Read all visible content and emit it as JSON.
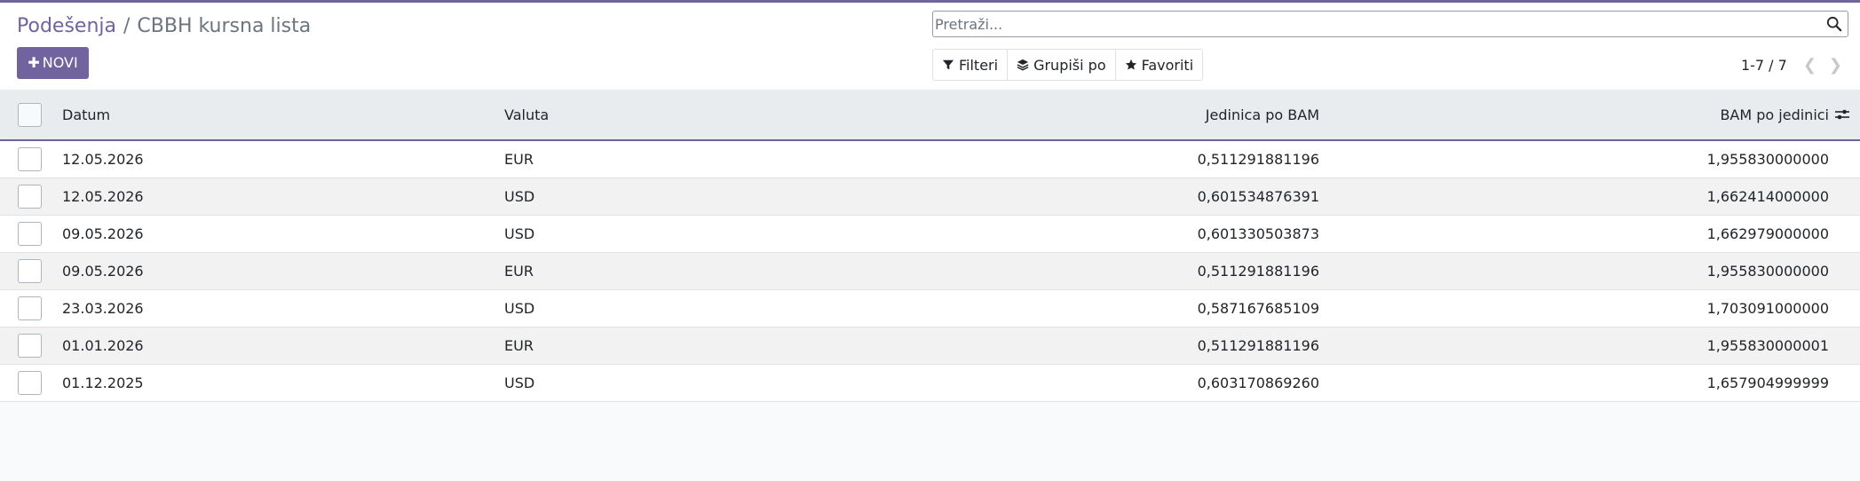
{
  "breadcrumb": {
    "parent": "Podešenja",
    "separator": "/",
    "current": "CBBH kursna lista"
  },
  "toolbar": {
    "new_label": "NOVI"
  },
  "search": {
    "placeholder": "Pretraži..."
  },
  "filters": {
    "filter_label": "Filteri",
    "group_label": "Grupiši po",
    "favorites_label": "Favoriti"
  },
  "pager": {
    "value": "1-7 / 7"
  },
  "table": {
    "columns": {
      "date": "Datum",
      "currency": "Valuta",
      "unit_per_bam": "Jedinica po BAM",
      "bam_per_unit": "BAM po jedinici"
    },
    "rows": [
      {
        "date": "12.05.2026",
        "currency": "EUR",
        "unit_per_bam": "0,511291881196",
        "bam_per_unit": "1,955830000000"
      },
      {
        "date": "12.05.2026",
        "currency": "USD",
        "unit_per_bam": "0,601534876391",
        "bam_per_unit": "1,662414000000"
      },
      {
        "date": "09.05.2026",
        "currency": "USD",
        "unit_per_bam": "0,601330503873",
        "bam_per_unit": "1,662979000000"
      },
      {
        "date": "09.05.2026",
        "currency": "EUR",
        "unit_per_bam": "0,511291881196",
        "bam_per_unit": "1,955830000000"
      },
      {
        "date": "23.03.2026",
        "currency": "USD",
        "unit_per_bam": "0,587167685109",
        "bam_per_unit": "1,703091000000"
      },
      {
        "date": "01.01.2026",
        "currency": "EUR",
        "unit_per_bam": "0,511291881196",
        "bam_per_unit": "1,955830000001"
      },
      {
        "date": "01.12.2025",
        "currency": "USD",
        "unit_per_bam": "0,603170869260",
        "bam_per_unit": "1,657904999999"
      }
    ]
  },
  "colors": {
    "brand": "#71639e",
    "header_bg": "#e9ecef"
  },
  "icons": {
    "search": "search-icon",
    "filter": "funnel-icon",
    "group": "layers-icon",
    "favorites": "star-icon",
    "prev": "chevron-left-icon",
    "next": "chevron-right-icon",
    "optional_columns": "sliders-icon"
  }
}
